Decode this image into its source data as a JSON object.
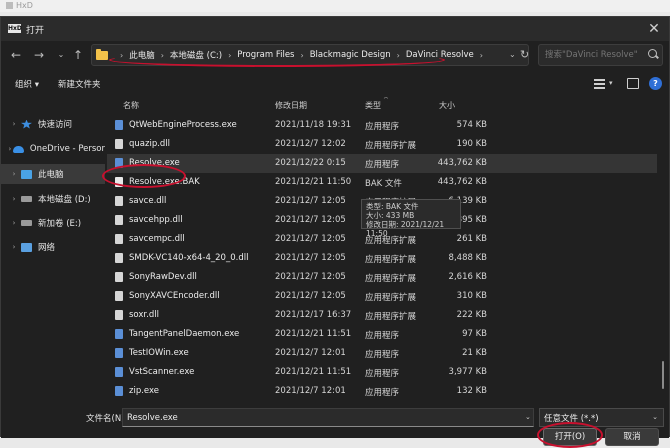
{
  "app_bar": {
    "title": "HxD"
  },
  "dialog": {
    "title": "打开",
    "icon_text": "HxD"
  },
  "address": {
    "crumbs": [
      "此电脑",
      "本地磁盘 (C:)",
      "Program Files",
      "Blackmagic Design",
      "DaVinci Resolve"
    ]
  },
  "search": {
    "placeholder": "搜索\"DaVinci Resolve\""
  },
  "toolbar": {
    "organize": "组织 ▾",
    "new_folder": "新建文件夹"
  },
  "sidebar": {
    "items": [
      {
        "label": "快速访问",
        "icon": "star-icon"
      },
      {
        "label": "OneDrive - Persor",
        "icon": "cloud-icon"
      },
      {
        "label": "此电脑",
        "icon": "computer-icon"
      },
      {
        "label": "本地磁盘 (D:)",
        "icon": "drive-icon"
      },
      {
        "label": "新加卷 (E:)",
        "icon": "drive-icon"
      },
      {
        "label": "网络",
        "icon": "network-icon"
      }
    ]
  },
  "columns": {
    "name": "名称",
    "date": "修改日期",
    "type": "类型",
    "size": "大小"
  },
  "files": [
    {
      "name": "QtWebEngineProcess.exe",
      "date": "2021/11/18 19:31",
      "type": "应用程序",
      "size": "574 KB",
      "kind": "exe"
    },
    {
      "name": "quazip.dll",
      "date": "2021/12/7 12:02",
      "type": "应用程序扩展",
      "size": "190 KB",
      "kind": "dll"
    },
    {
      "name": "Resolve.exe",
      "date": "2021/12/22 0:15",
      "type": "应用程序",
      "size": "443,762 KB",
      "kind": "exe"
    },
    {
      "name": "Resolve.exe.BAK",
      "date": "2021/12/21 11:50",
      "type": "BAK 文件",
      "size": "443,762 KB",
      "kind": "file"
    },
    {
      "name": "savce.dll",
      "date": "2021/12/7 12:05",
      "type": "应用程序扩展",
      "size": "6,139 KB",
      "kind": "dll"
    },
    {
      "name": "savcehpp.dll",
      "date": "2021/12/7 12:05",
      "type": "应用程序扩展",
      "size": "6,895 KB",
      "kind": "dll"
    },
    {
      "name": "savcempc.dll",
      "date": "2021/12/7 12:05",
      "type": "应用程序扩展",
      "size": "261 KB",
      "kind": "dll"
    },
    {
      "name": "SMDK-VC140-x64-4_20_0.dll",
      "date": "2021/12/7 12:05",
      "type": "应用程序扩展",
      "size": "8,488 KB",
      "kind": "dll"
    },
    {
      "name": "SonyRawDev.dll",
      "date": "2021/12/7 12:05",
      "type": "应用程序扩展",
      "size": "2,616 KB",
      "kind": "dll"
    },
    {
      "name": "SonyXAVCEncoder.dll",
      "date": "2021/12/7 12:05",
      "type": "应用程序扩展",
      "size": "310 KB",
      "kind": "dll"
    },
    {
      "name": "soxr.dll",
      "date": "2021/12/17 16:37",
      "type": "应用程序扩展",
      "size": "222 KB",
      "kind": "dll"
    },
    {
      "name": "TangentPanelDaemon.exe",
      "date": "2021/12/21 11:51",
      "type": "应用程序",
      "size": "97 KB",
      "kind": "exe"
    },
    {
      "name": "TestIOWin.exe",
      "date": "2021/12/7 12:01",
      "type": "应用程序",
      "size": "21 KB",
      "kind": "exe"
    },
    {
      "name": "VstScanner.exe",
      "date": "2021/12/21 11:51",
      "type": "应用程序",
      "size": "3,977 KB",
      "kind": "exe"
    },
    {
      "name": "zip.exe",
      "date": "2021/12/7 12:01",
      "type": "应用程序",
      "size": "132 KB",
      "kind": "exe"
    }
  ],
  "tooltip": {
    "line1": "类型: BAK 文件",
    "line2": "大小: 433 MB",
    "line3": "修改日期: 2021/12/21 11:50"
  },
  "bottom": {
    "filename_label": "文件名(N):",
    "filename_value": "Resolve.exe",
    "filetype": "任意文件 (*.*)",
    "open": "打开(O)",
    "cancel": "取消"
  },
  "colors": {
    "annotation": "#c8102e",
    "folder": "#f3c24a",
    "accent": "#2f6fd6"
  }
}
